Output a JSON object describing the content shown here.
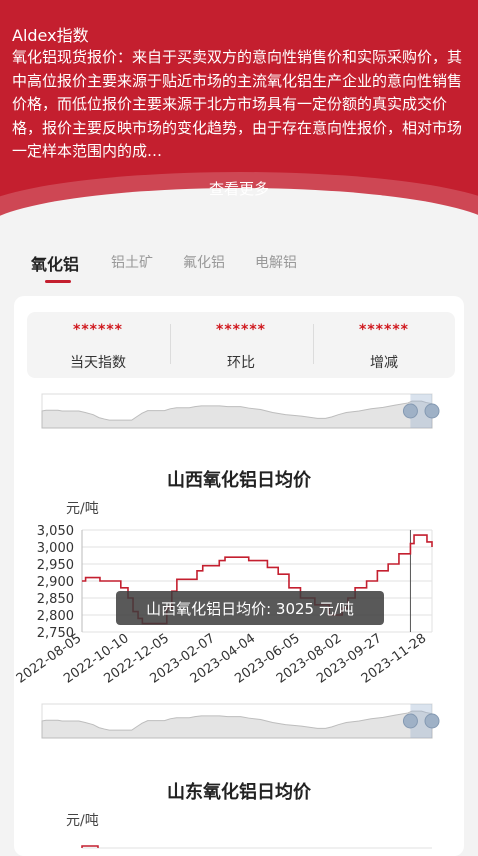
{
  "header": {
    "title": "Aldex指数",
    "description": "氧化铝现货报价：来自于买卖双方的意向性销售价和实际采购价，其中高位报价主要来源于贴近市场的主流氧化铝生产企业的意向性销售价格，而低位报价主要来源于北方市场具有一定份额的真实成交价格，报价主要反映市场的变化趋势，由于存在意向性报价，相对市场一定样本范围内的成…",
    "more_label": "查看更多"
  },
  "tabs": [
    {
      "label": "氧化铝",
      "active": true
    },
    {
      "label": "铝土矿",
      "active": false
    },
    {
      "label": "氟化铝",
      "active": false
    },
    {
      "label": "电解铝",
      "active": false
    }
  ],
  "stats": [
    {
      "value": "******",
      "label": "当天指数"
    },
    {
      "value": "******",
      "label": "环比"
    },
    {
      "value": "******",
      "label": "增减"
    }
  ],
  "colors": {
    "brand": "#c41f2f",
    "series": "#c41f2f",
    "stat_value": "#d0191f"
  },
  "chart_data": [
    {
      "type": "line",
      "title": "山西氧化铝日均价",
      "ylabel": "元/吨",
      "ylim": [
        2750,
        3050
      ],
      "yticks": [
        2750,
        2800,
        2850,
        2900,
        2950,
        3000,
        3050
      ],
      "xticks": [
        "2022-08-05",
        "2022-10-10",
        "2022-12-05",
        "2023-02-07",
        "2023-04-04",
        "2023-06-05",
        "2023-08-02",
        "2023-09-27",
        "2023-11-28"
      ],
      "grid": true,
      "series": [
        {
          "values": [
            [
              "2022-08-05",
              2900
            ],
            [
              "2022-08-10",
              2910
            ],
            [
              "2022-08-25",
              2910
            ],
            [
              "2022-08-30",
              2900
            ],
            [
              "2022-09-20",
              2900
            ],
            [
              "2022-09-28",
              2880
            ],
            [
              "2022-10-08",
              2850
            ],
            [
              "2022-10-15",
              2810
            ],
            [
              "2022-10-22",
              2790
            ],
            [
              "2022-10-28",
              2775
            ],
            [
              "2022-11-25",
              2775
            ],
            [
              "2022-12-01",
              2820
            ],
            [
              "2022-12-08",
              2870
            ],
            [
              "2022-12-15",
              2905
            ],
            [
              "2023-01-05",
              2905
            ],
            [
              "2023-01-12",
              2930
            ],
            [
              "2023-01-20",
              2945
            ],
            [
              "2023-02-05",
              2945
            ],
            [
              "2023-02-12",
              2960
            ],
            [
              "2023-02-20",
              2970
            ],
            [
              "2023-03-15",
              2970
            ],
            [
              "2023-03-25",
              2960
            ],
            [
              "2023-04-10",
              2960
            ],
            [
              "2023-04-20",
              2940
            ],
            [
              "2023-05-05",
              2920
            ],
            [
              "2023-05-20",
              2880
            ],
            [
              "2023-06-05",
              2850
            ],
            [
              "2023-06-25",
              2830
            ],
            [
              "2023-07-15",
              2800
            ],
            [
              "2023-07-25",
              2800
            ],
            [
              "2023-08-02",
              2820
            ],
            [
              "2023-08-10",
              2850
            ],
            [
              "2023-08-20",
              2880
            ],
            [
              "2023-09-05",
              2900
            ],
            [
              "2023-09-20",
              2930
            ],
            [
              "2023-10-05",
              2950
            ],
            [
              "2023-10-20",
              2980
            ],
            [
              "2023-11-05",
              3010
            ],
            [
              "2023-11-10",
              3035
            ],
            [
              "2023-11-22",
              3035
            ],
            [
              "2023-11-28",
              3015
            ],
            [
              "2023-12-05",
              3000
            ]
          ]
        }
      ],
      "tooltip": {
        "label": "山西氧化铝日均价: 3025 元/吨",
        "x": "2023-11-05"
      }
    },
    {
      "type": "line",
      "title": "山东氧化铝日均价",
      "ylabel": "元/吨"
    }
  ]
}
